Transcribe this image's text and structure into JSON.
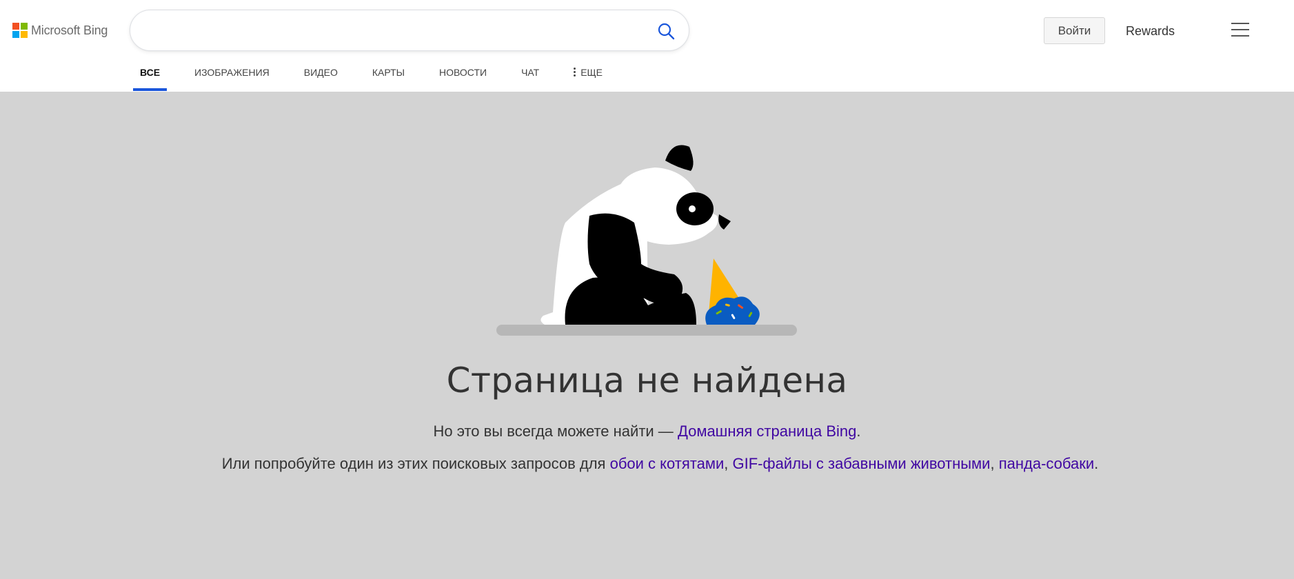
{
  "header": {
    "logo_text": "Microsoft Bing",
    "logo_colors": [
      "#f25022",
      "#7fba00",
      "#00a4ef",
      "#ffb900"
    ],
    "search": {
      "value": "",
      "placeholder": ""
    },
    "signin_label": "Войти",
    "rewards_label": "Rewards"
  },
  "nav": {
    "items": [
      {
        "label": "Все"
      },
      {
        "label": "Изображения"
      },
      {
        "label": "Видео"
      },
      {
        "label": "Карты"
      },
      {
        "label": "Новости"
      },
      {
        "label": "Чат"
      },
      {
        "label": "Еще"
      }
    ],
    "active_index": 0,
    "accent_color": "#1a56db"
  },
  "error": {
    "title": "Страница не найдена",
    "line1_prefix": "Но это вы всегда можете найти — ",
    "home_link": "Домашняя страница Bing",
    "line1_suffix": ".",
    "line2_prefix": "Или попробуйте один из этих поисковых запросов для ",
    "suggestions": [
      "обои с котятами",
      "GIF-файлы с забавными животными",
      "панда-собаки"
    ],
    "separator": ", ",
    "line2_suffix": ".",
    "link_color": "#4007a2"
  },
  "icons": {
    "search": "search-icon",
    "menu": "hamburger-menu-icon",
    "more": "vertical-dots-icon",
    "illustration": "sad-panda-with-dropped-ice-cream-illustration"
  }
}
